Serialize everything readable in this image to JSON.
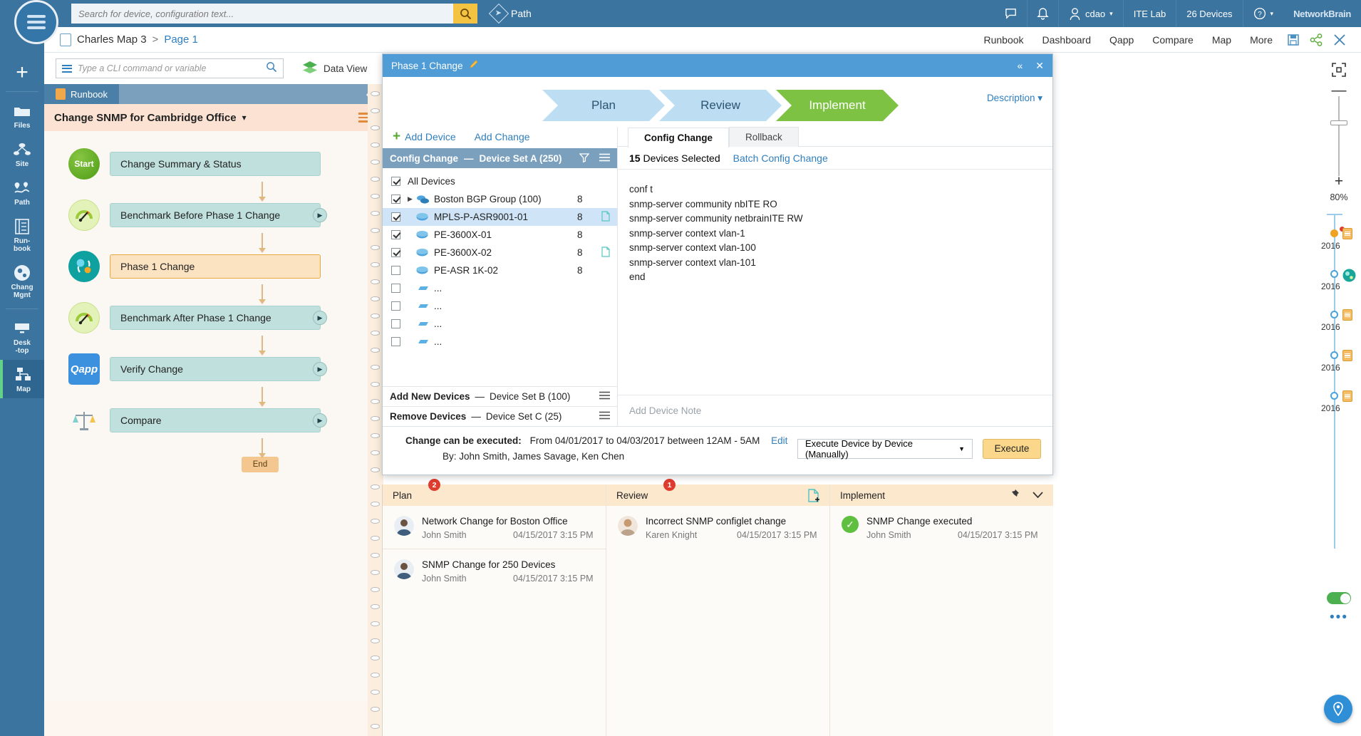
{
  "topbar": {
    "search_placeholder": "Search for device, configuration text...",
    "search_value": "",
    "path_label": "Path",
    "user": "cdao",
    "tenant": "ITE Lab",
    "devices": "26 Devices",
    "logo": "NetworkBrain",
    "icons": [
      "chat-icon",
      "bell-icon",
      "user-icon",
      "help-icon"
    ]
  },
  "breadcrumb": {
    "map_name": "Charles Map 3",
    "separator": ">",
    "page": "Page 1"
  },
  "menus": {
    "items": [
      "Runbook",
      "Dashboard",
      "Qapp",
      "Compare",
      "Map",
      "More"
    ],
    "save_icon": "save-icon",
    "share_icon": "share-icon",
    "close_icon": "close-icon"
  },
  "rail": {
    "add_label": "+",
    "items": [
      {
        "label": "Files",
        "icon": "folder-icon"
      },
      {
        "label": "Site",
        "icon": "site-tree-icon"
      },
      {
        "label": "Path",
        "icon": "path-icon"
      },
      {
        "label": "Run-\nbook",
        "icon": "runbook-icon"
      },
      {
        "label": "Chang\nMgnt",
        "icon": "change-mgmt-icon"
      },
      {
        "label": "Desk\n-top",
        "icon": "desktop-icon"
      },
      {
        "label": "Map",
        "icon": "map-icon"
      }
    ]
  },
  "cli": {
    "placeholder": "Type a CLI command or variable",
    "value": "",
    "data_view_label": "Data View"
  },
  "runbook": {
    "tab_label": "Runbook",
    "title": "Change SNMP for Cambridge Office",
    "nodes": [
      {
        "icon": "start-icon",
        "label": "Change Summary & Status",
        "highlight": false,
        "play": false
      },
      {
        "icon": "benchmark-icon",
        "label": "Benchmark Before Phase 1 Change",
        "highlight": false,
        "play": true
      },
      {
        "icon": "change-icon",
        "label": "Phase 1 Change",
        "highlight": true,
        "play": false
      },
      {
        "icon": "benchmark-icon",
        "label": "Benchmark After Phase 1 Change",
        "highlight": false,
        "play": true
      },
      {
        "icon": "qapp-icon",
        "label": "Verify Change",
        "highlight": false,
        "play": true
      },
      {
        "icon": "compare-icon",
        "label": "Compare",
        "highlight": false,
        "play": true
      }
    ],
    "start_label": "Start",
    "qapp_label": "Qapp",
    "end_label": "End"
  },
  "modal": {
    "title": "Phase 1 Change",
    "edit_icon": "pencil-icon",
    "collapse_icon": "collapse-icon",
    "close_icon": "close-icon",
    "description_label": "Description ▾",
    "steps": [
      {
        "label": "Plan",
        "active": false
      },
      {
        "label": "Review",
        "active": false
      },
      {
        "label": "Implement",
        "active": true
      }
    ],
    "add_device": "Add Device",
    "add_change": "Add Change",
    "device_set": {
      "title": "Config Change",
      "dash": "—",
      "subtitle": "Device Set A (250)",
      "filter_icon": "filter-icon",
      "menu_icon": "menu-icon"
    },
    "devices": [
      {
        "name": "All Devices",
        "checked": true,
        "count": "",
        "icon": "",
        "doc": false,
        "expand": false,
        "selected": false
      },
      {
        "name": "Boston BGP Group (100)",
        "checked": true,
        "count": "8",
        "icon": "group-icon",
        "doc": false,
        "expand": true,
        "selected": false
      },
      {
        "name": "MPLS-P-ASR9001-01",
        "checked": true,
        "count": "8",
        "icon": "router-icon",
        "doc": true,
        "expand": false,
        "selected": true
      },
      {
        "name": "PE-3600X-01",
        "checked": true,
        "count": "8",
        "icon": "router-icon",
        "doc": false,
        "expand": false,
        "selected": false
      },
      {
        "name": "PE-3600X-02",
        "checked": true,
        "count": "8",
        "icon": "router-icon",
        "doc": true,
        "expand": false,
        "selected": false
      },
      {
        "name": "PE-ASR 1K-02",
        "checked": false,
        "count": "8",
        "icon": "router-icon",
        "doc": false,
        "expand": false,
        "selected": false
      },
      {
        "name": "...",
        "checked": false,
        "count": "",
        "icon": "switch-icon",
        "doc": false,
        "expand": false,
        "selected": false
      },
      {
        "name": "...",
        "checked": false,
        "count": "",
        "icon": "switch-icon",
        "doc": false,
        "expand": false,
        "selected": false
      },
      {
        "name": "...",
        "checked": false,
        "count": "",
        "icon": "switch-icon",
        "doc": false,
        "expand": false,
        "selected": false
      },
      {
        "name": "...",
        "checked": false,
        "count": "",
        "icon": "switch-icon",
        "doc": false,
        "expand": false,
        "selected": false
      }
    ],
    "add_new_devices": {
      "label": "Add New Devices",
      "dash": "—",
      "set": "Device Set B (100)"
    },
    "remove_devices": {
      "label": "Remove Devices",
      "dash": "—",
      "set": "Device Set C (25)"
    },
    "tabs": [
      {
        "label": "Config Change",
        "active": true
      },
      {
        "label": "Rollback",
        "active": false
      }
    ],
    "selected_count": "15",
    "selected_suffix": "Devices Selected",
    "batch_link": "Batch Config Change",
    "config_lines": [
      "conf t",
      "snmp-server community nbITE RO",
      "snmp-server community netbrainITE RW",
      "snmp-server context vlan-1",
      "snmp-server context vlan-100",
      "snmp-server context vlan-101",
      "end"
    ],
    "note_placeholder": "Add Device Note",
    "execution": {
      "label": "Change can be executed:",
      "from_label": "From",
      "from_date": "04/01/2017",
      "to_label": "to",
      "to_date": "04/03/2017",
      "between_label": "between",
      "time_range": "12AM - 5AM",
      "edit_link": "Edit",
      "by_label": "By:",
      "by_names": "John Smith, James Savage, Ken Chen",
      "mode": "Execute Device by Device (Manually)",
      "execute_button": "Execute"
    }
  },
  "activity": {
    "columns": [
      {
        "title": "Plan",
        "badge": "2",
        "items": [
          {
            "title": "Network Change for Boston Office",
            "who": "John Smith",
            "when": "04/15/2017 3:15 PM",
            "status": "avatar"
          },
          {
            "title": "SNMP Change for 250 Devices",
            "who": "John Smith",
            "when": "04/15/2017 3:15 PM",
            "status": "avatar"
          }
        ]
      },
      {
        "title": "Review",
        "badge": "1",
        "doc_icon": "add-document-icon",
        "items": [
          {
            "title": "Incorrect SNMP configlet change",
            "who": "Karen Knight",
            "when": "04/15/2017 3:15 PM",
            "status": "avatar"
          }
        ]
      },
      {
        "title": "Implement",
        "badge": "",
        "pin_icon": "pin-icon",
        "chevron_icon": "chevron-down-icon",
        "items": [
          {
            "title": "SNMP Change executed",
            "who": "John Smith",
            "when": "04/15/2017 3:15 PM",
            "status": "check"
          }
        ]
      }
    ]
  },
  "right_rail": {
    "fit_icon": "fit-screen-icon",
    "zoom_out": "—",
    "zoom_in": "+",
    "zoom_level": "80%",
    "timeline": [
      {
        "year": "2016",
        "filled": true,
        "alert": true,
        "icon": "note-icon"
      },
      {
        "year": "2016",
        "filled": false,
        "alert": false,
        "icon": "change-icon"
      },
      {
        "year": "2016",
        "filled": false,
        "alert": false,
        "icon": "note-icon"
      },
      {
        "year": "2016",
        "filled": false,
        "alert": false,
        "icon": "note-icon"
      },
      {
        "year": "2016",
        "filled": false,
        "alert": false,
        "icon": "note-icon"
      }
    ],
    "toggle_on": true,
    "more_icon": "more-dots-icon",
    "fab_icon": "pin-map-icon"
  }
}
